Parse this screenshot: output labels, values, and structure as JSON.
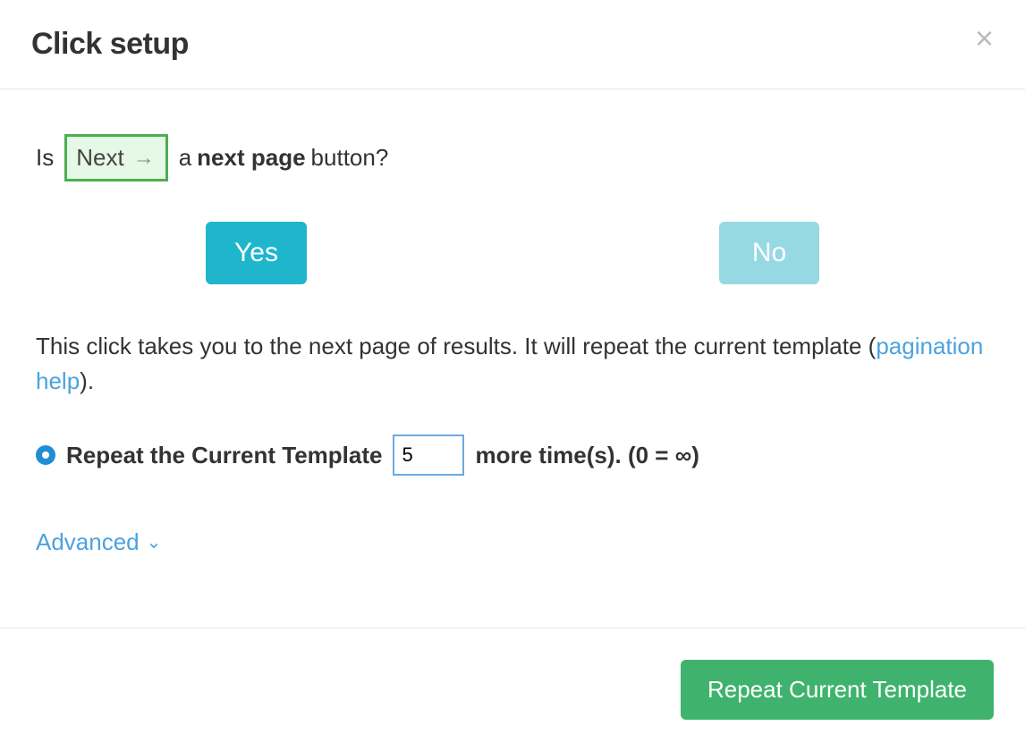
{
  "modal": {
    "title": "Click setup",
    "close_label": "×"
  },
  "question": {
    "prefix": "Is",
    "preview_text": "Next",
    "preview_arrow": "→",
    "mid_a": "a",
    "mid_bold": "next page",
    "suffix": "button?"
  },
  "buttons": {
    "yes": "Yes",
    "no": "No"
  },
  "description": {
    "line1": "This click takes you to the next page of results. It will repeat the current template (",
    "link": "pagination help",
    "line2": ")."
  },
  "repeat": {
    "label_before": "Repeat the Current Template",
    "value": "5",
    "label_after": "more time(s). (0 = ∞)"
  },
  "advanced": {
    "label": "Advanced",
    "chevron": "⌄"
  },
  "footer": {
    "primary": "Repeat Current Template"
  }
}
